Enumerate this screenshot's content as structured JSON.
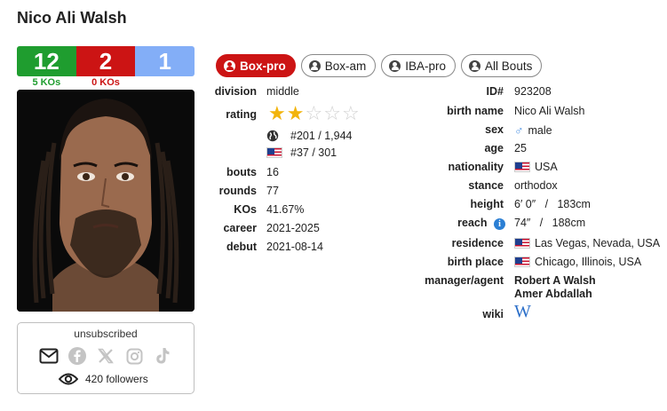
{
  "boxer": {
    "name": "Nico Ali Walsh"
  },
  "record": {
    "wins": "12",
    "losses": "2",
    "draws": "1",
    "win_kos": "5 KOs",
    "loss_kos": "0 KOs"
  },
  "subscription": {
    "status": "unsubscribed",
    "followers": "420 followers",
    "icons": [
      "envelope-icon",
      "facebook-icon",
      "x-twitter-icon",
      "instagram-icon",
      "tiktok-icon"
    ]
  },
  "tabs": [
    {
      "label": "Box-pro",
      "active": true
    },
    {
      "label": "Box-am",
      "active": false
    },
    {
      "label": "IBA-pro",
      "active": false
    },
    {
      "label": "All Bouts",
      "active": false
    }
  ],
  "left_info": {
    "division_label": "division",
    "division": "middle",
    "rating_label": "rating",
    "rating_stars": 2,
    "rating_max": 5,
    "world_rank": "#201 / 1,944",
    "us_rank": "#37 / 301",
    "bouts_label": "bouts",
    "bouts": "16",
    "rounds_label": "rounds",
    "rounds": "77",
    "kos_label": "KOs",
    "kos": "41.67%",
    "career_label": "career",
    "career": "2021-2025",
    "debut_label": "debut",
    "debut": "2021-08-14"
  },
  "right_info": {
    "id_label": "ID#",
    "id": "923208",
    "birth_name_label": "birth name",
    "birth_name": "Nico Ali Walsh",
    "sex_label": "sex",
    "sex": "male",
    "age_label": "age",
    "age": "25",
    "nationality_label": "nationality",
    "nationality": "USA",
    "stance_label": "stance",
    "stance": "orthodox",
    "height_label": "height",
    "height": "6′ 0″   /   183cm",
    "reach_label": "reach",
    "reach": "74″   /   188cm",
    "residence_label": "residence",
    "residence": "Las Vegas, Nevada, USA",
    "birth_place_label": "birth place",
    "birth_place": "Chicago, Illinois, USA",
    "manager_label": "manager/agent",
    "manager_1": "Robert A Walsh",
    "manager_2": "Amer Abdallah",
    "wiki_label": "wiki",
    "wiki_glyph": "W"
  },
  "colors": {
    "win": "#1f9d2f",
    "loss": "#cc1414",
    "draw": "#83aef7",
    "star": "#f2b40c",
    "link": "#2b6fc9"
  }
}
